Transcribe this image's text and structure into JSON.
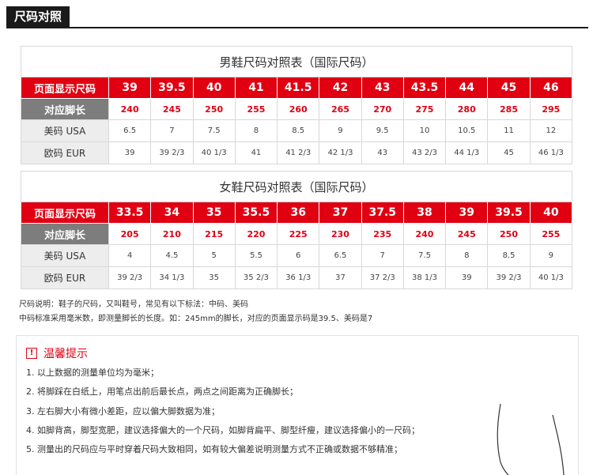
{
  "header": {
    "title": "尺码对照"
  },
  "men": {
    "title": "男鞋尺码对照表（国际尺码）",
    "rows": [
      {
        "label": "页面显示尺码",
        "values": [
          "39",
          "39.5",
          "40",
          "41",
          "41.5",
          "42",
          "43",
          "43.5",
          "44",
          "45",
          "46"
        ]
      },
      {
        "label": "对应脚长",
        "values": [
          "240",
          "245",
          "250",
          "255",
          "260",
          "265",
          "270",
          "275",
          "280",
          "285",
          "295"
        ]
      },
      {
        "label": "美码 USA",
        "values": [
          "6.5",
          "7",
          "7.5",
          "8",
          "8.5",
          "9",
          "9.5",
          "10",
          "10.5",
          "11",
          "12"
        ]
      },
      {
        "label": "欧码 EUR",
        "values": [
          "39",
          "39 2/3",
          "40 1/3",
          "41",
          "41 2/3",
          "42 1/3",
          "43",
          "43 2/3",
          "44 1/3",
          "45",
          "46 1/3"
        ]
      }
    ]
  },
  "women": {
    "title": "女鞋尺码对照表（国际尺码）",
    "rows": [
      {
        "label": "页面显示尺码",
        "values": [
          "33.5",
          "34",
          "35",
          "35.5",
          "36",
          "37",
          "37.5",
          "38",
          "39",
          "39.5",
          "40"
        ]
      },
      {
        "label": "对应脚长",
        "values": [
          "205",
          "210",
          "215",
          "220",
          "225",
          "230",
          "235",
          "240",
          "245",
          "250",
          "255"
        ]
      },
      {
        "label": "美码 USA",
        "values": [
          "4",
          "4.5",
          "5",
          "5.5",
          "6",
          "6.5",
          "7",
          "7.5",
          "8",
          "8.5",
          "9"
        ]
      },
      {
        "label": "欧码 EUR",
        "values": [
          "39 2/3",
          "34 1/3",
          "35",
          "35 2/3",
          "36 1/3",
          "37",
          "37 2/3",
          "38 1/3",
          "39",
          "39 2/3",
          "40 1/3"
        ]
      }
    ]
  },
  "notes": {
    "line1": "尺码说明：鞋子的尺码，又叫鞋号，常见有以下标法：中码、美码",
    "line2": "中码标准采用毫米数，即测量脚长的长度。如：245mm的脚长，对应的页面显示码是39.5、美码是7"
  },
  "tips": {
    "icon": "warning-icon",
    "title": "温馨提示",
    "items": [
      "1. 以上数据的测量单位均为毫米；",
      "2. 将脚踩在白纸上，用笔点出前后最长点，两点之间距离为正确脚长；",
      "3. 左右脚大小有微小差距，应以偏大脚数据为准；",
      "4. 如脚背高，脚型宽肥，建议选择偏大的一个尺码，如脚背扁平、脚型纤瘦，建议选择偏小的一尺码；",
      "5. 测量出的尺码应与平时穿着尺码大致相同，如有较大偏差说明测量方式不正确或数据不够精准；"
    ]
  }
}
